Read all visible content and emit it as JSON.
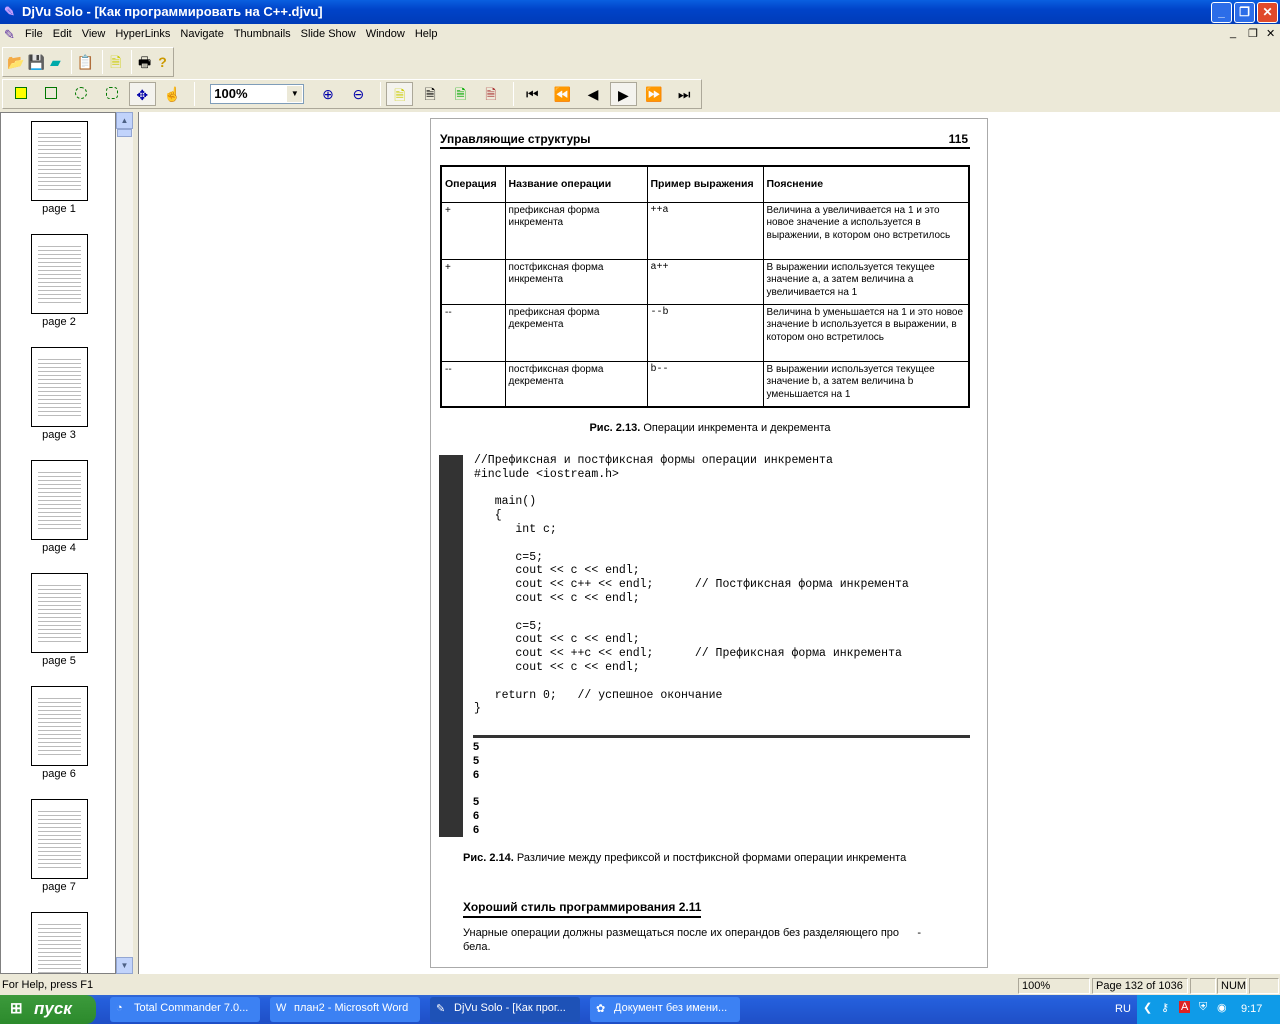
{
  "window": {
    "title": "DjVu Solo - [Как программировать на C++.djvu]"
  },
  "menu": [
    "File",
    "Edit",
    "View",
    "HyperLinks",
    "Navigate",
    "Thumbnails",
    "Slide Show",
    "Window",
    "Help"
  ],
  "toolbar": {
    "zoom": "100%"
  },
  "thumbnails": [
    "page 1",
    "page 2",
    "page 3",
    "page 4",
    "page 5",
    "page 6",
    "page 7"
  ],
  "page": {
    "header": "Управляющие структуры",
    "number": "115",
    "table": {
      "headers": [
        "Операция",
        "Название операции",
        "Пример выражения",
        "Пояснение"
      ],
      "rows": [
        [
          "+",
          "префиксная форма инкремента",
          "++a",
          "Величина a увеличивается на 1 и это новое значение a используется в выражении, в котором оно встретилось"
        ],
        [
          "+",
          "постфиксная форма инкремента",
          "a++",
          "В выражении используется текущее значение a, а затем величина a увеличивается на 1"
        ],
        [
          "--",
          "префиксная форма декремента",
          "--b",
          "Величина b уменьшается на 1 и это новое значение b используется в выражении, в котором оно встретилось"
        ],
        [
          "--",
          "постфиксная форма декремента",
          "b--",
          "В выражении используется текущее значение b, а затем величина b уменьшается на 1"
        ]
      ]
    },
    "fig13_label": "Рис. 2.13.",
    "fig13_text": "Операции инкремента и декремента",
    "code": [
      "//Префиксная и постфиксная формы операции инкремента",
      "#include <iostream.h>",
      "",
      "   main()",
      "   {",
      "      int c;",
      "",
      "      c=5;",
      "      cout << c << endl;",
      "      cout << c++ << endl;      // Постфиксная форма инкремента",
      "      cout << c << endl;",
      "",
      "      c=5;",
      "      cout << c << endl;",
      "      cout << ++c << endl;      // Префиксная форма инкремента",
      "      cout << c << endl;",
      "",
      "   return 0;   // успешное окончание",
      "}"
    ],
    "output": [
      "5",
      "5",
      "6",
      "",
      "5",
      "6",
      "6"
    ],
    "fig14_label": "Рис. 2.14.",
    "fig14_text": "Различие между префиксой и постфиксной формами операции инкремента",
    "tip_title": "Хороший стиль программирования 2.11",
    "tip_text": "Унарные операции должны размещаться после их операндов без разделяющего про      -\nбела."
  },
  "status": {
    "help": "For Help, press F1",
    "zoom": "100%",
    "page": "Page 132 of 1036",
    "num": "NUM"
  },
  "taskbar": {
    "start": "пуск",
    "tasks": [
      "Total Commander 7.0...",
      "план2 - Microsoft Word",
      "DjVu Solo - [Как прог...",
      "Документ без имени..."
    ],
    "lang": "RU",
    "clock": "9:17"
  }
}
